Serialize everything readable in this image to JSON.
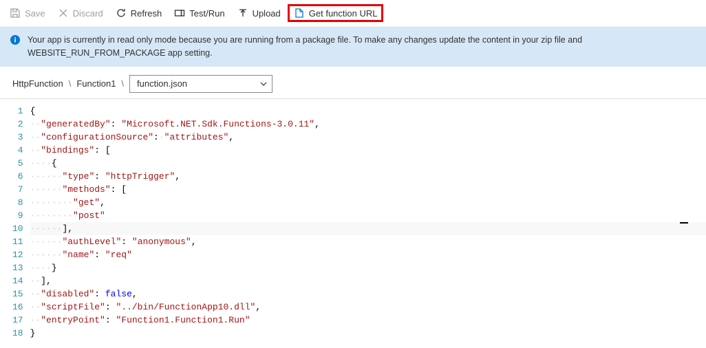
{
  "toolbar": {
    "save": {
      "label": "Save"
    },
    "discard": {
      "label": "Discard"
    },
    "refresh": {
      "label": "Refresh"
    },
    "testrun": {
      "label": "Test/Run"
    },
    "upload": {
      "label": "Upload"
    },
    "geturl": {
      "label": "Get function URL"
    }
  },
  "info": {
    "message": "Your app is currently in read only mode because you are running from a package file. To make any changes update the content in your zip file and WEBSITE_RUN_FROM_PACKAGE app setting."
  },
  "breadcrumb": {
    "root": "HttpFunction",
    "func": "Function1",
    "file": "function.json"
  },
  "editor": {
    "line_numbers": [
      "1",
      "2",
      "3",
      "4",
      "5",
      "6",
      "7",
      "8",
      "9",
      "10",
      "11",
      "12",
      "13",
      "14",
      "15",
      "16",
      "17",
      "18"
    ],
    "json_content": {
      "generatedBy": "Microsoft.NET.Sdk.Functions-3.0.11",
      "configurationSource": "attributes",
      "bindings": [
        {
          "type": "httpTrigger",
          "methods": [
            "get",
            "post"
          ],
          "authLevel": "anonymous",
          "name": "req"
        }
      ],
      "disabled": false,
      "scriptFile": "../bin/FunctionApp10.dll",
      "entryPoint": "Function1.Function1.Run"
    }
  },
  "chart_data": null
}
